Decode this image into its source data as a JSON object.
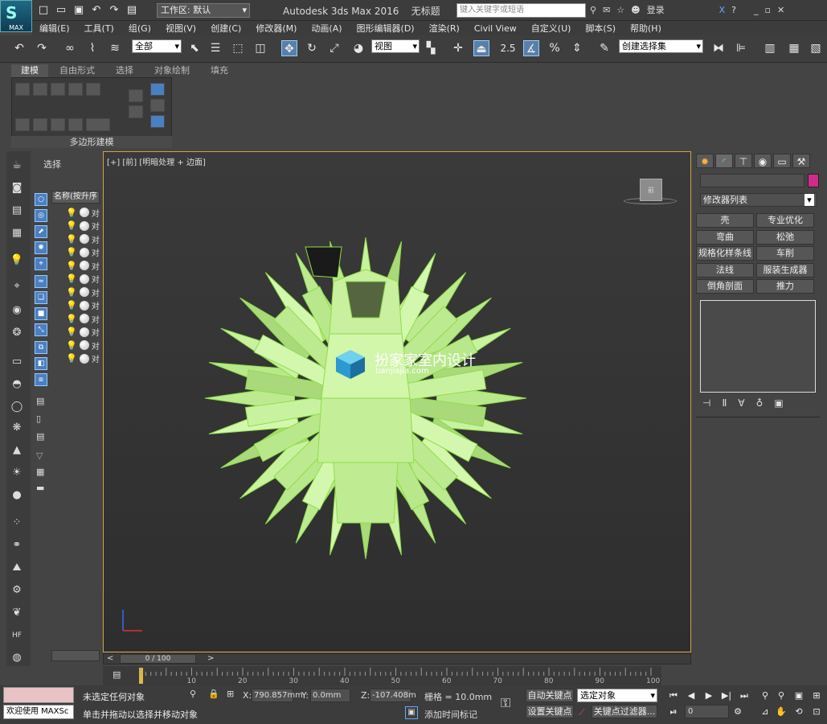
{
  "app": {
    "title": "Autodesk 3ds Max 2016",
    "doc": "无标题",
    "logo_text": "MAX"
  },
  "workspace": {
    "label": "工作区: 默认"
  },
  "search": {
    "placeholder": "键入关键字或短语"
  },
  "login": {
    "label": "登录"
  },
  "menus": [
    "编辑(E)",
    "工具(T)",
    "组(G)",
    "视图(V)",
    "创建(C)",
    "修改器(M)",
    "动画(A)",
    "图形编辑器(D)",
    "渲染(R)",
    "Civil View",
    "自定义(U)",
    "脚本(S)",
    "帮助(H)"
  ],
  "toolbar": {
    "filter": "全部",
    "refcoord": "视图",
    "snap_label": "2.5",
    "selection_set": "创建选择集"
  },
  "ribbon": {
    "tabs": [
      "建模",
      "自由形式",
      "选择",
      "对象绘制",
      "填充"
    ],
    "panel_label": "多边形建模"
  },
  "scene": {
    "title": "选择",
    "header": "名称(按升序",
    "rows": [
      "对",
      "对",
      "对",
      "对",
      "对",
      "对",
      "对",
      "对",
      "对",
      "对",
      "对",
      "对"
    ]
  },
  "viewport": {
    "label": "[+] [前] [明暗处理 + 边面]",
    "watermark_cn": "扮家家室内设计",
    "watermark_en": "banjiajia.com"
  },
  "command_panel": {
    "modifier_list": "修改器列表",
    "buttons": [
      "壳",
      "专业优化",
      "弯曲",
      "松弛",
      "规格化样条线",
      "车削",
      "法线",
      "服装生成器",
      "倒角剖面",
      "推力"
    ]
  },
  "timeline": {
    "slider": "0 / 100",
    "ticks": [
      "10",
      "20",
      "30",
      "40",
      "50",
      "60",
      "70",
      "80",
      "90",
      "100"
    ]
  },
  "status": {
    "welcome": "欢迎使用 MAXSc",
    "line1": "未选定任何对象",
    "line2": "单击并拖动以选择并移动对象",
    "x": "790.857mm",
    "y": "0.0mm",
    "z": "-107.408m",
    "grid": "栅格 = 10.0mm",
    "add_tag": "添加时间标记",
    "auto_key": "自动关键点",
    "set_key": "设置关键点",
    "sel_obj": "选定对象",
    "key_filter": "关键点过滤器...",
    "frame": "0"
  },
  "colors": {
    "accent": "#5a7fa8",
    "viewport_border": "#d1a347",
    "mesh_fill": "#c6ef9a",
    "mesh_edge": "#8fdc4a"
  }
}
